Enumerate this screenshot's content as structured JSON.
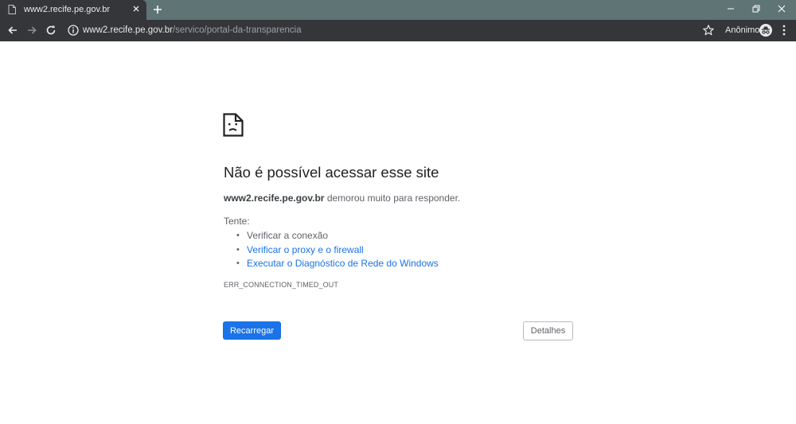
{
  "tab": {
    "title": "www2.recife.pe.gov.br",
    "favicon": "document-icon"
  },
  "toolbar": {
    "url_host": "www2.recife.pe.gov.br",
    "url_path": "/servico/portal-da-transparencia",
    "profile_label": "Anônimo"
  },
  "error_page": {
    "heading": "Não é possível acessar esse site",
    "summary_host": "www2.recife.pe.gov.br",
    "summary_text": " demorou muito para responder.",
    "try_label": "Tente:",
    "suggestions": [
      {
        "label": "Verificar a conexão",
        "is_link": false
      },
      {
        "label": "Verificar o proxy e o firewall",
        "is_link": true
      },
      {
        "label": "Executar o Diagnóstico de Rede do Windows",
        "is_link": true
      }
    ],
    "error_code": "ERR_CONNECTION_TIMED_OUT",
    "reload_button": "Recarregar",
    "details_button": "Detalhes"
  },
  "colors": {
    "tabstrip_bg": "#5f7474",
    "toolbar_bg": "#35363a",
    "accent_blue": "#1a73e8",
    "text_gray": "#5f6368",
    "heading": "#202124"
  }
}
